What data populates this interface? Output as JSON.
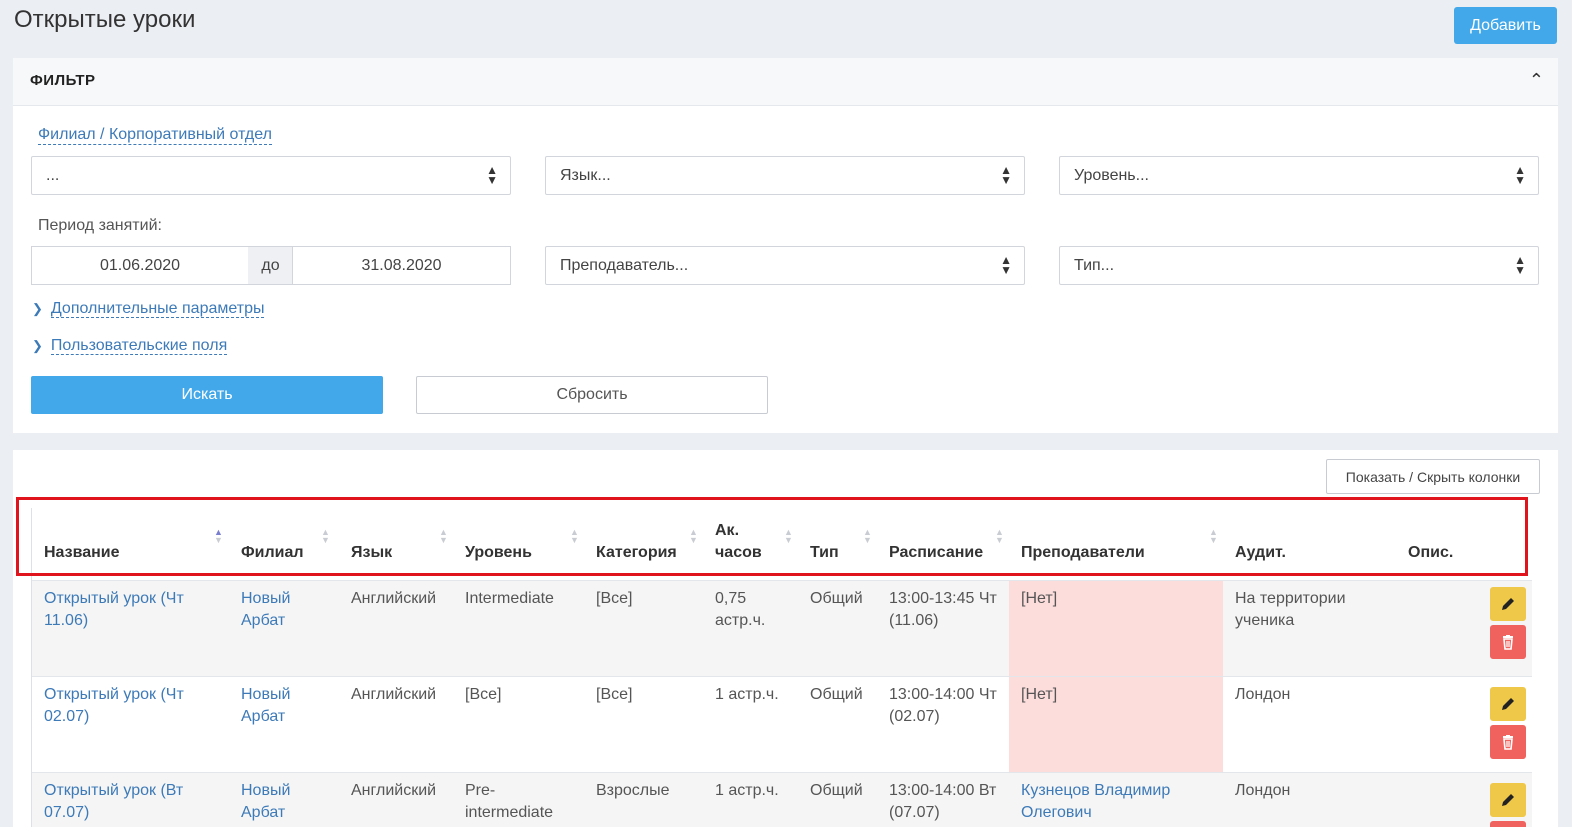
{
  "header": {
    "title": "Открытые уроки",
    "add_label": "Добавить"
  },
  "filter": {
    "title": "ФИЛЬТР",
    "branch_link": "Филиал / Корпоративный отдел",
    "branch_value": "...",
    "language_placeholder": "Язык...",
    "level_placeholder": "Уровень...",
    "period_label": "Период занятий:",
    "date_from": "01.06.2020",
    "date_sep": "до",
    "date_to": "31.08.2020",
    "teacher_placeholder": "Преподаватель...",
    "type_placeholder": "Тип...",
    "extra_params": "Дополнительные параметры",
    "custom_fields": "Пользовательские поля",
    "search_label": "Искать",
    "reset_label": "Сбросить"
  },
  "table": {
    "toggle_columns": "Показать / Скрыть колонки",
    "columns": {
      "name": "Название",
      "branch": "Филиал",
      "language": "Язык",
      "level": "Уровень",
      "category": "Категория",
      "hours_1": "Ак.",
      "hours_2": "часов",
      "type": "Тип",
      "schedule": "Расписание",
      "teachers": "Преподаватели",
      "room": "Аудит.",
      "desc": "Опис."
    },
    "rows": [
      {
        "name_1": "Открытый урок (Чт",
        "name_2": "11.06)",
        "branch_1": "Новый",
        "branch_2": "Арбат",
        "language": "Английский",
        "level_1": "Intermediate",
        "level_2": "",
        "category": "[Все]",
        "hours_1": "0,75",
        "hours_2": "астр.ч.",
        "type": "Общий",
        "schedule_1": "13:00-13:45 Чт",
        "schedule_2": "(11.06)",
        "teachers_1": "[Нет]",
        "teachers_2": "",
        "room_1": "На территории",
        "room_2": "ученика"
      },
      {
        "name_1": "Открытый урок (Чт",
        "name_2": "02.07)",
        "branch_1": "Новый",
        "branch_2": "Арбат",
        "language": "Английский",
        "level_1": "[Все]",
        "level_2": "",
        "category": "[Все]",
        "hours_1": "1 астр.ч.",
        "hours_2": "",
        "type": "Общий",
        "schedule_1": "13:00-14:00 Чт",
        "schedule_2": "(02.07)",
        "teachers_1": "[Нет]",
        "teachers_2": "",
        "room_1": "Лондон",
        "room_2": ""
      },
      {
        "name_1": "Открытый урок (Вт",
        "name_2": "07.07)",
        "branch_1": "Новый",
        "branch_2": "Арбат",
        "language": "Английский",
        "level_1": "Pre-",
        "level_2": "intermediate",
        "category": "Взрослые",
        "hours_1": "1 астр.ч.",
        "hours_2": "",
        "type": "Общий",
        "schedule_1": "13:00-14:00 Вт",
        "schedule_2": "(07.07)",
        "teachers_1": "Кузнецов Владимир",
        "teachers_2": "Олегович",
        "room_1": "Лондон",
        "room_2": ""
      }
    ]
  },
  "colors": {
    "primary": "#42a8e9",
    "edit": "#efc84a",
    "delete": "#f0625e",
    "no_teacher_bg": "#fddcdc",
    "highlight": "#e0141c"
  },
  "icons": {
    "collapse": "chevron-up-icon",
    "select": "select-arrows-icon",
    "sort": "sort-icon",
    "edit": "pencil-icon",
    "delete": "trash-icon"
  }
}
